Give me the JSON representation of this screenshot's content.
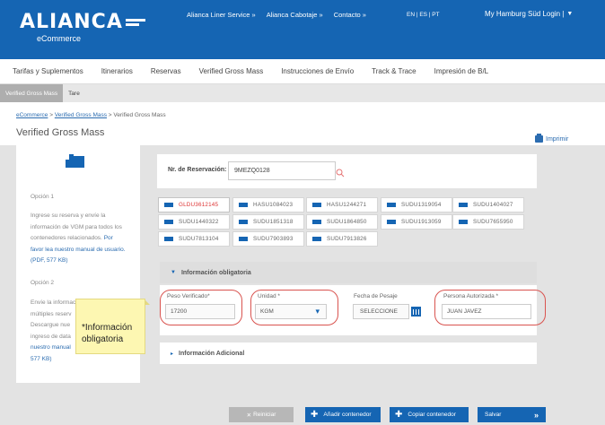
{
  "header": {
    "logo_text": "ALIANCA",
    "logo_sub": "eCommerce",
    "links": [
      "Alianca Liner Service »",
      "Alianca Cabotaje »",
      "Contacto »"
    ],
    "lang": "EN | ES | PT",
    "user_menu": "My Hamburg Süd Login |"
  },
  "main_nav": [
    "Tarifas y Suplementos",
    "Itinerarios",
    "Reservas",
    "Verified Gross Mass",
    "Instrucciones de Envío",
    "Track & Trace",
    "Impresión de B/L"
  ],
  "sub_nav": [
    "Verified Gross Mass",
    "Tare"
  ],
  "breadcrumb": {
    "part1": "eCommerce",
    "sep1": " > ",
    "part2": "Verified Gross Mass",
    "sep2": " > ",
    "current": "Verified Gross Mass"
  },
  "page_title": "Verified Gross Mass",
  "print_label": "Imprimir",
  "left_panel": {
    "opcion1_title": "Opción 1",
    "opcion1_lines": [
      "Ingrese su reserva y envíe la",
      "información de VGM para todos los",
      "contenedores relacionados."
    ],
    "link_lines": [
      "Por",
      "favor lea nuestro manual de usuario.",
      "(PDF, 577 KB)"
    ],
    "opcion2_title": "Opción 2",
    "opcion2_lines": [
      "Envíe la informació",
      "múltiples reserv",
      "Descargue nue",
      "ingreso de data"
    ],
    "link2_lines": [
      "nuestro manual",
      "577 KB)"
    ]
  },
  "tooltip": {
    "line1": "*Información",
    "line2": "obligatoria"
  },
  "search": {
    "label": "Nr. de Reservación:",
    "value": "9MEZQ0128"
  },
  "containers": [
    "GLDU3612145",
    "HASU1084023",
    "HASU1244271",
    "SUDU1319054",
    "SUDU1404027",
    "SUDU1440322",
    "SUDU1851318",
    "SUDU1864850",
    "SUDU1913059",
    "SUDU7655950",
    "SUDU7813104",
    "SUDU7903893",
    "SUDU7913826"
  ],
  "section_required": "Información obligatoria",
  "section_additional": "Información Adicional",
  "form": {
    "peso_label": "Peso Verificado*",
    "peso_value": "17200",
    "unidad_label": "Unidad *",
    "unidad_value": "KGM",
    "fecha_label": "Fecha de Pesaje",
    "fecha_value": "SELECCIONE",
    "persona_label": "Persona Autorizada *",
    "persona_value": "JUAN JAVEZ"
  },
  "buttons": {
    "reset": "Reiniciar",
    "add": "Añadir contenedor",
    "copy": "Copiar contenedor",
    "save": "Salvar"
  },
  "colors": {
    "brand_blue": "#1565b3",
    "highlight_red": "#d9534f",
    "tooltip_yellow": "#fdf7b2"
  }
}
